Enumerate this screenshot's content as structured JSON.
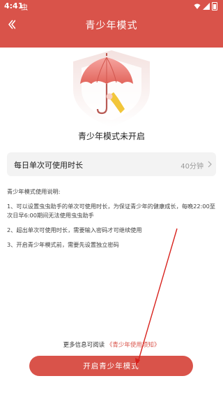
{
  "status_bar": {
    "time": "4:41",
    "app_icon": "虫",
    "icons": [
      "wifi-icon",
      "signal-icon",
      "battery-icon"
    ]
  },
  "header": {
    "back_icon": "back-arrow-icon",
    "title": "青少年模式",
    "color": "#d9534a"
  },
  "illustration": {
    "icon": "umbrella-shield-icon"
  },
  "status_text": "青少年模式未开启",
  "setting": {
    "label": "每日单次可使用时长",
    "value": "40分钟",
    "icon": "chevron-right-icon"
  },
  "instructions": {
    "heading": "青少年模式使用说明:",
    "items": [
      "1、可以设置虫虫助手的单次可使用时长，为保证青少年的健康成长，每晚22:00至次日早6:00期间无法使用虫虫助手",
      "2、超出单次可使用时长，需要输入密码才可继续使用",
      "3、开启青少年模式前，需要先设置独立密码"
    ]
  },
  "footer": {
    "prefix": "更多信息可阅读",
    "link": "《青少年使用须知》"
  },
  "primary_button": {
    "label": "开启青少年模式"
  }
}
